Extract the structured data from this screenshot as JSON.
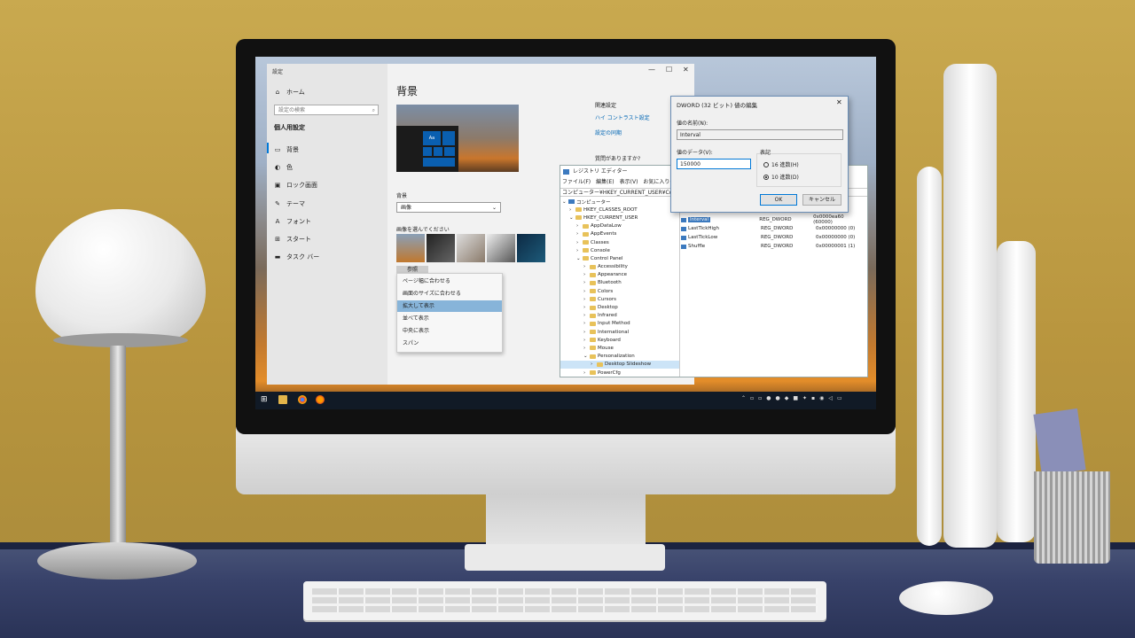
{
  "settings": {
    "title": "設定",
    "window_controls": {
      "minimize": "—",
      "maximize": "☐",
      "close": "✕"
    },
    "home_label": "ホーム",
    "search_placeholder": "設定の検索",
    "section_heading": "個人用設定",
    "nav": [
      {
        "label": "背景",
        "icon": "image-icon"
      },
      {
        "label": "色",
        "icon": "palette-icon"
      },
      {
        "label": "ロック画面",
        "icon": "monitor-icon"
      },
      {
        "label": "テーマ",
        "icon": "brush-icon"
      },
      {
        "label": "フォント",
        "icon": "font-icon"
      },
      {
        "label": "スタート",
        "icon": "start-icon"
      },
      {
        "label": "タスク バー",
        "icon": "taskbar-icon"
      }
    ],
    "page_title": "背景",
    "preview_tile_text": "Aa",
    "background_label": "背景",
    "background_value": "画像",
    "choose_image_label": "画像を選んでください",
    "browse_label": "参照",
    "fit_menu": [
      {
        "label": "ページ幅に合わせる",
        "selected": false
      },
      {
        "label": "画面のサイズに合わせる",
        "selected": false
      },
      {
        "label": "拡大して表示",
        "selected": true
      },
      {
        "label": "並べて表示",
        "selected": false
      },
      {
        "label": "中央に表示",
        "selected": false
      },
      {
        "label": "スパン",
        "selected": false
      }
    ],
    "related_heading": "関連設定",
    "related_links": [
      "ハイ コントラスト設定",
      "設定の同期"
    ],
    "question_heading": "質問がありますか?"
  },
  "regedit": {
    "title": "レジストリ エディター",
    "menu": [
      "ファイル(F)",
      "編集(E)",
      "表示(V)",
      "お気に入り(A)"
    ],
    "address": "コンピューター¥HKEY_CURRENT_USER¥Control P",
    "tree": [
      {
        "label": "コンピューター",
        "indent": 0,
        "expanded": true
      },
      {
        "label": "HKEY_CLASSES_ROOT",
        "indent": 1,
        "expanded": false
      },
      {
        "label": "HKEY_CURRENT_USER",
        "indent": 1,
        "expanded": true
      },
      {
        "label": "AppDataLow",
        "indent": 2,
        "expanded": false
      },
      {
        "label": "AppEvents",
        "indent": 2,
        "expanded": false
      },
      {
        "label": "Classes",
        "indent": 2,
        "expanded": false
      },
      {
        "label": "Console",
        "indent": 2,
        "expanded": false
      },
      {
        "label": "Control Panel",
        "indent": 2,
        "expanded": true
      },
      {
        "label": "Accessibility",
        "indent": 3,
        "expanded": false
      },
      {
        "label": "Appearance",
        "indent": 3,
        "expanded": false
      },
      {
        "label": "Bluetooth",
        "indent": 3,
        "expanded": false
      },
      {
        "label": "Colors",
        "indent": 3,
        "expanded": false
      },
      {
        "label": "Cursors",
        "indent": 3,
        "expanded": false
      },
      {
        "label": "Desktop",
        "indent": 3,
        "expanded": false
      },
      {
        "label": "Infrared",
        "indent": 3,
        "expanded": false
      },
      {
        "label": "Input Method",
        "indent": 3,
        "expanded": false
      },
      {
        "label": "International",
        "indent": 3,
        "expanded": false
      },
      {
        "label": "Keyboard",
        "indent": 3,
        "expanded": false
      },
      {
        "label": "Mouse",
        "indent": 3,
        "expanded": false
      },
      {
        "label": "Personalization",
        "indent": 3,
        "expanded": true
      },
      {
        "label": "Desktop Slideshow",
        "indent": 4,
        "expanded": false,
        "selected": true
      },
      {
        "label": "PowerCfg",
        "indent": 3,
        "expanded": false
      }
    ],
    "values": [
      {
        "name": "Interval",
        "type": "REG_DWORD",
        "data": "0x0000ea60 (60000)",
        "selected": true
      },
      {
        "name": "LastTickHigh",
        "type": "REG_DWORD",
        "data": "0x00000000 (0)"
      },
      {
        "name": "LastTickLow",
        "type": "REG_DWORD",
        "data": "0x00000000 (0)"
      },
      {
        "name": "Shuffle",
        "type": "REG_DWORD",
        "data": "0x00000001 (1)"
      }
    ]
  },
  "dword_dialog": {
    "title": "DWORD (32 ビット) 値の編集",
    "close": "✕",
    "name_label": "値の名前(N):",
    "name_value": "Interval",
    "data_label": "値のデータ(V):",
    "data_value": "150000",
    "base_label": "表記",
    "base_hex": "16 進数(H)",
    "base_dec": "10 進数(D)",
    "base_selected": "dec",
    "ok": "OK",
    "cancel": "キャンセル"
  },
  "colors": {
    "accent": "#0078d7",
    "taskbar": "#111a26",
    "wall": "#c9a94f"
  }
}
